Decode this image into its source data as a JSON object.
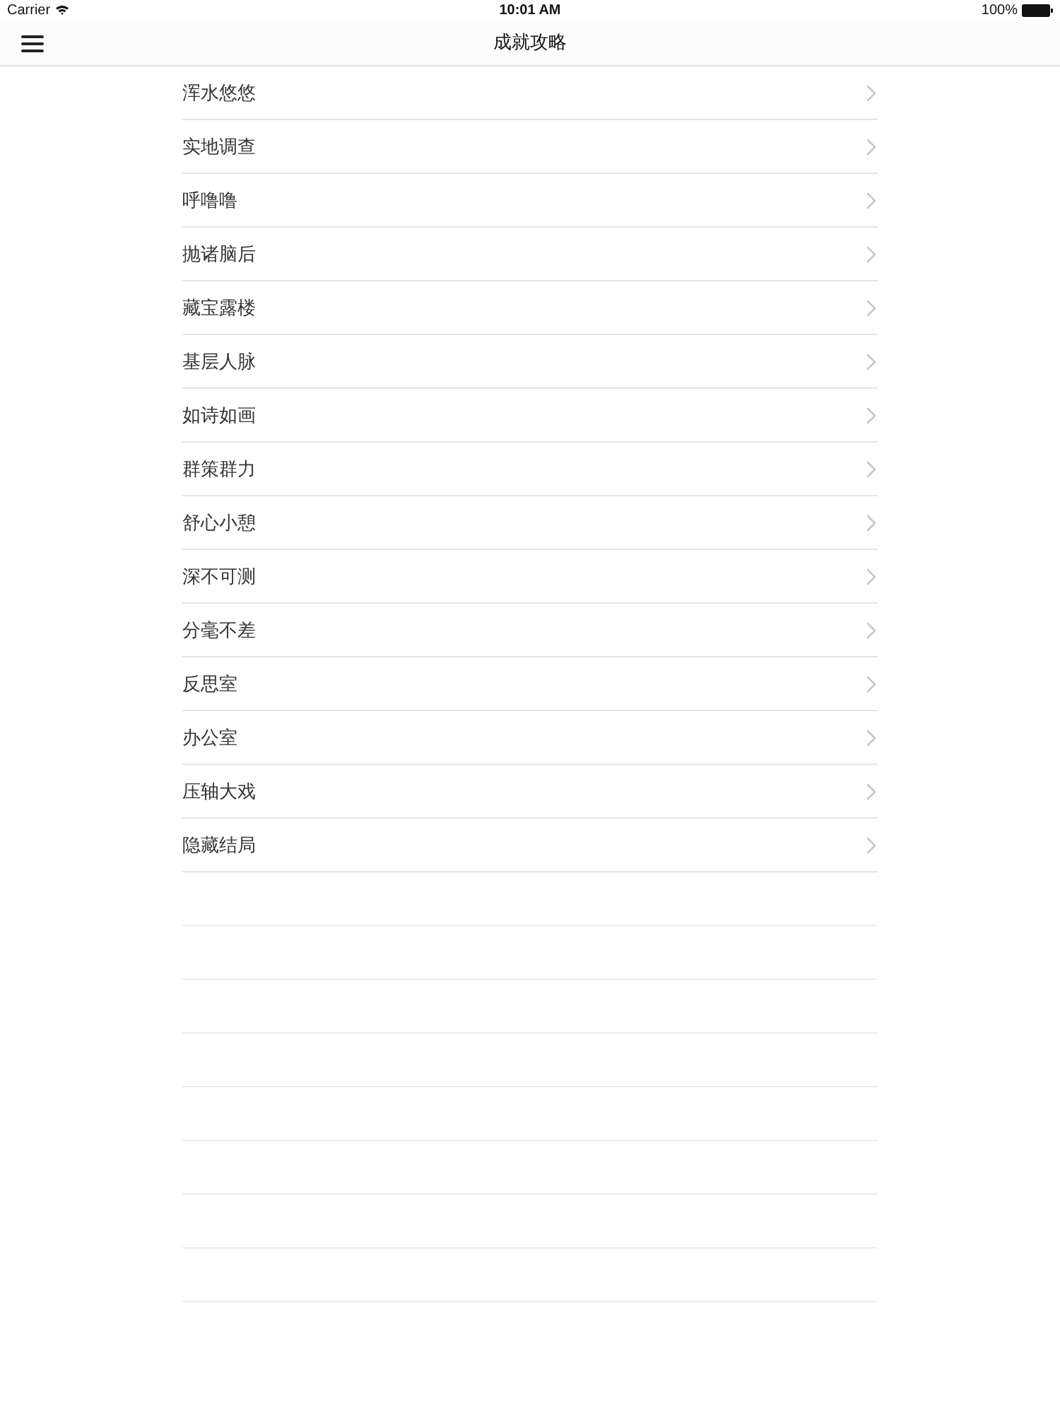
{
  "status_bar": {
    "carrier": "Carrier",
    "time": "10:01 AM",
    "battery": "100%"
  },
  "nav_bar": {
    "title": "成就攻略"
  },
  "list": {
    "items": [
      {
        "label": "浑水悠悠"
      },
      {
        "label": "实地调查"
      },
      {
        "label": "呼噜噜"
      },
      {
        "label": "抛诸脑后"
      },
      {
        "label": "藏宝露楼"
      },
      {
        "label": "基层人脉"
      },
      {
        "label": "如诗如画"
      },
      {
        "label": "群策群力"
      },
      {
        "label": "舒心小憩"
      },
      {
        "label": "深不可测"
      },
      {
        "label": "分毫不差"
      },
      {
        "label": "反思室"
      },
      {
        "label": "办公室"
      },
      {
        "label": "压轴大戏"
      },
      {
        "label": "隐藏结局"
      }
    ]
  }
}
